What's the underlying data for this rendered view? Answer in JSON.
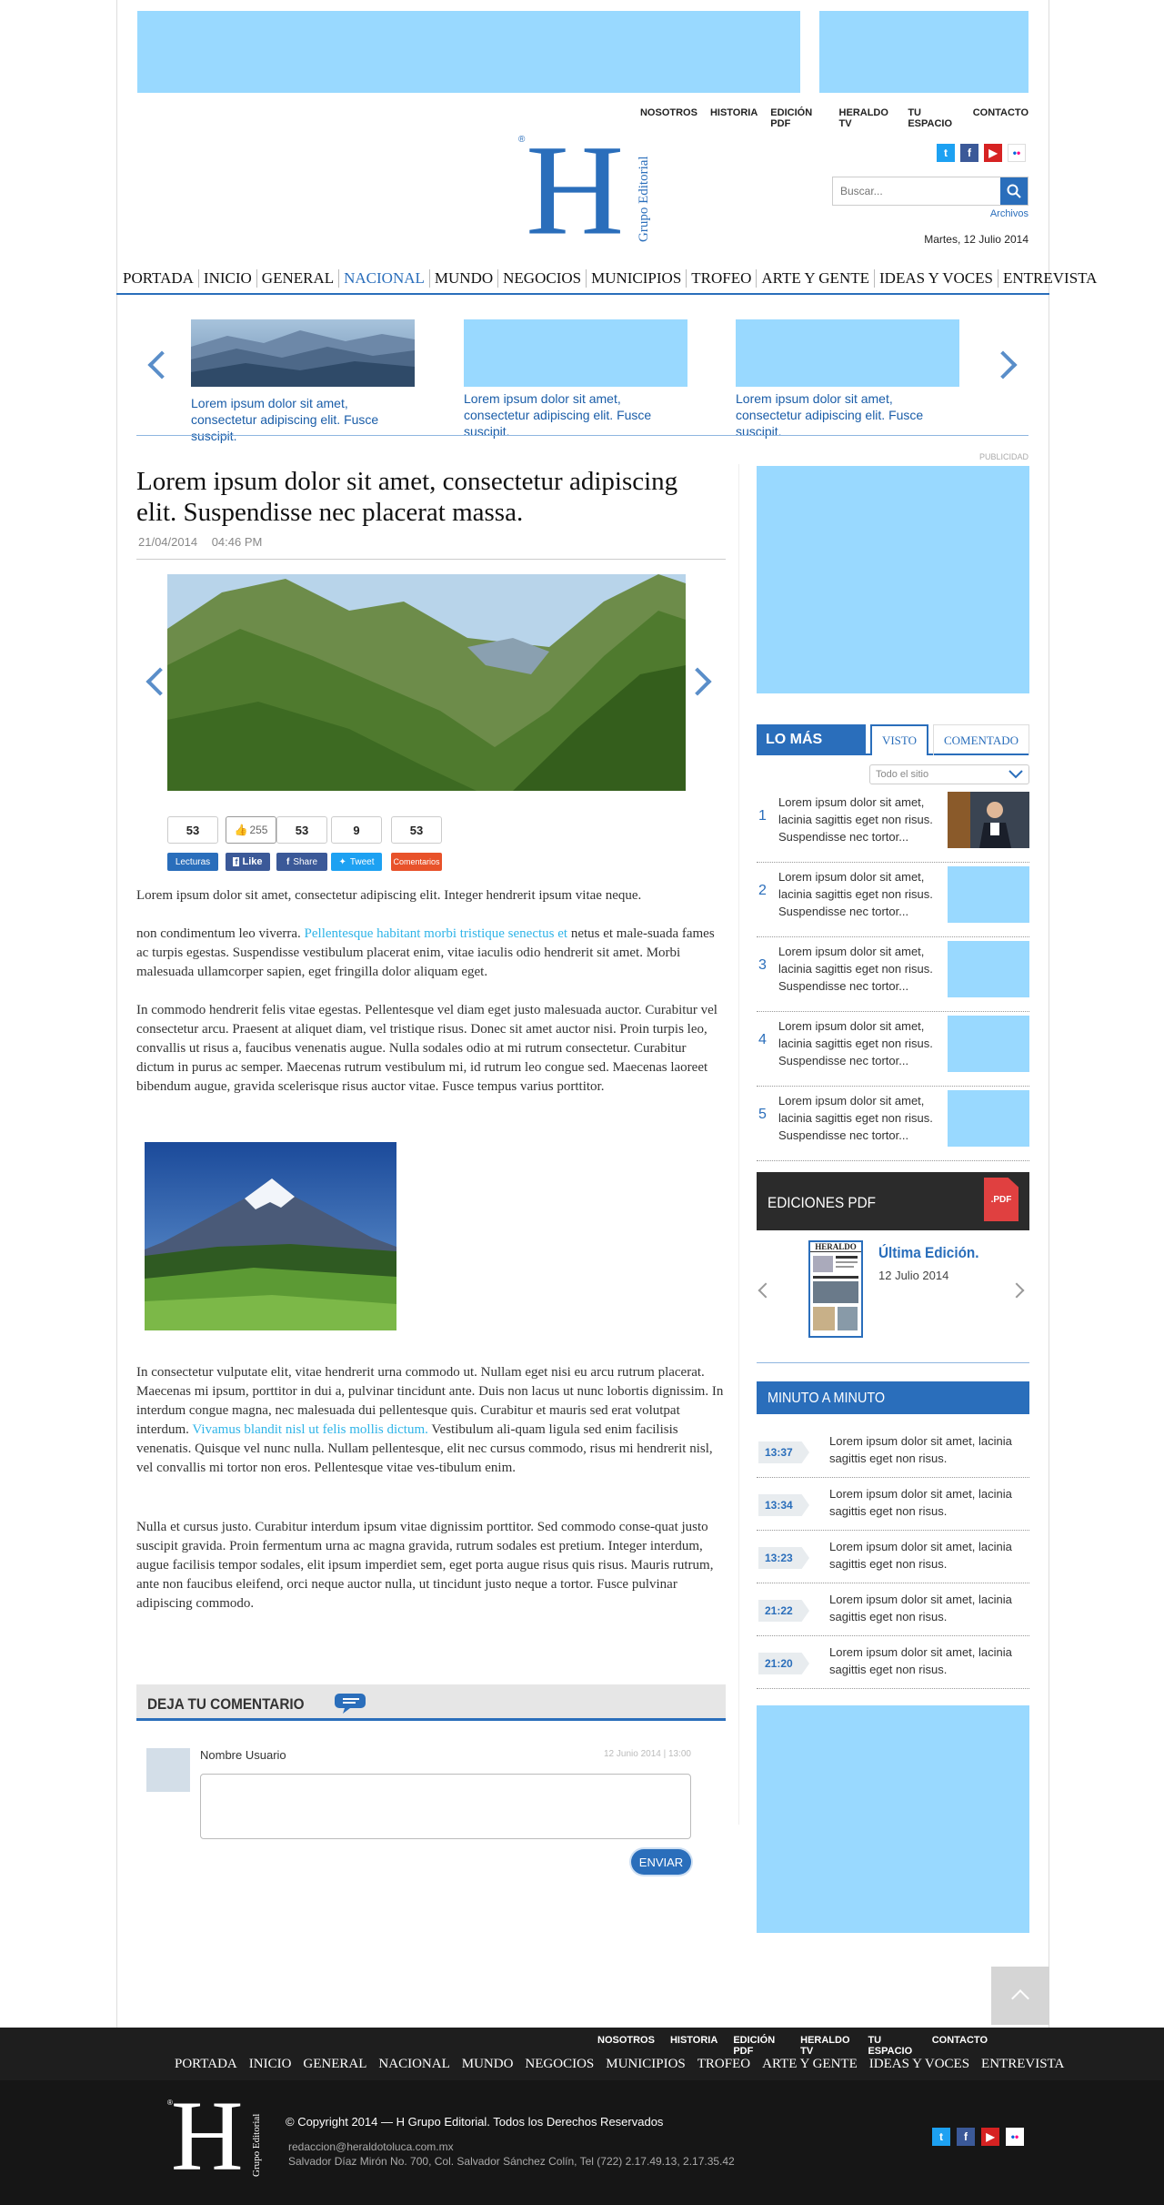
{
  "top_nav": [
    "NOSOTROS",
    "HISTORIA",
    "EDICIÓN PDF",
    "HERALDO TV",
    "TU ESPACIO",
    "CONTACTO"
  ],
  "logo": {
    "letter": "H",
    "text": "Grupo Editorial",
    "mark": "®"
  },
  "search": {
    "placeholder": "Buscar...",
    "archives": "Archivos"
  },
  "date": "Martes, 12 Julio 2014",
  "main_nav": [
    "PORTADA",
    "INICIO",
    "GENERAL",
    "NACIONAL",
    "MUNDO",
    "NEGOCIOS",
    "MUNICIPIOS",
    "TROFEO",
    "ARTE Y GENTE",
    "IDEAS Y VOCES",
    "ENTREVISTA"
  ],
  "main_nav_active": "NACIONAL",
  "carousel": [
    {
      "caption": "Lorem ipsum dolor sit amet, consectetur adipiscing elit. Fusce suscipit."
    },
    {
      "caption": "Lorem ipsum dolor sit amet, consectetur adipiscing elit. Fusce suscipit."
    },
    {
      "caption": "Lorem ipsum dolor sit amet, consectetur adipiscing elit. Fusce suscipit."
    }
  ],
  "ad_label": "PUBLICIDAD",
  "article": {
    "title": "Lorem ipsum dolor sit amet, consectetur adipiscing elit. Suspendisse nec placerat massa.",
    "date": "21/04/2014",
    "time": "04:46 PM",
    "stats": {
      "lecturas": "53",
      "like": "255",
      "share": "53",
      "tweet": "9",
      "comentarios": "53",
      "lecturas_label": "Lecturas",
      "like_label": "Like",
      "share_label": "Share",
      "tweet_label": "Tweet",
      "comentarios_label": "Comentarios"
    },
    "p1": "Lorem ipsum dolor sit amet, consectetur adipiscing elit. Integer hendrerit ipsum vitae neque.",
    "p2a": "non condimentum leo viverra. ",
    "p2link": "Pellentesque habitant morbi tristique senectus et",
    "p2b": " netus et male-suada fames ac turpis egestas. Suspendisse vestibulum placerat enim, vitae iaculis odio hendrerit sit amet. Morbi malesuada ullamcorper sapien, eget fringilla dolor aliquam eget.",
    "p3": "In commodo hendrerit felis vitae egestas. Pellentesque vel diam eget justo malesuada auctor. Curabitur vel consectetur arcu. Praesent at aliquet diam, vel tristique risus. Donec sit amet auctor nisi. Proin turpis leo, convallis ut risus a, faucibus venenatis augue. Nulla sodales odio at mi rutrum consectetur. Curabitur dictum in purus ac semper. Maecenas rutrum vestibulum mi, id rutrum leo congue sed. Maecenas laoreet bibendum augue, gravida scelerisque risus auctor vitae. Fusce tempus varius porttitor.",
    "p4a": "In consectetur vulputate elit, vitae hendrerit urna commodo ut. Nullam eget nisi eu arcu rutrum placerat. Maecenas mi ipsum, porttitor in dui a, pulvinar tincidunt ante. Duis non lacus ut nunc lobortis dignissim. In interdum congue magna, nec malesuada dui pellentesque quis. Curabitur et mauris sed erat volutpat interdum. ",
    "p4link": "Vivamus blandit nisl ut felis mollis dictum.",
    "p4b": " Vestibulum ali-quam ligula sed enim facilisis venenatis. Quisque vel nunc nulla. Nullam pellentesque, elit nec cursus commodo, risus mi hendrerit nisl, vel convallis mi tortor non eros. Pellentesque vitae ves-tibulum enim.",
    "p5": "Nulla et cursus justo. Curabitur interdum ipsum vitae dignissim porttitor. Sed commodo conse-quat justo suscipit gravida. Proin fermentum urna ac magna gravida, rutrum sodales est pretium. Integer interdum, augue facilisis tempor sodales, elit ipsum imperdiet sem, eget porta augue risus quis risus. Mauris rutrum, ante non faucibus eleifend, orci neque auctor nulla, ut tincidunt justo neque a tortor. Fusce pulvinar adipiscing commodo."
  },
  "comment": {
    "title": "DEJA TU COMENTARIO",
    "user": "Nombre Usuario",
    "date": "12 Junio 2014 | 13:00",
    "submit": "ENVIAR"
  },
  "lo_mas": {
    "title": "LO MÁS",
    "tab1": "VISTO",
    "tab2": "COMENTADO",
    "select": "Todo el sitio",
    "items": [
      {
        "num": "1",
        "text": "Lorem ipsum dolor sit amet, lacinia sagittis eget non risus. Suspendisse nec tortor..."
      },
      {
        "num": "2",
        "text": "Lorem ipsum dolor sit amet, lacinia sagittis eget non risus. Suspendisse nec tortor..."
      },
      {
        "num": "3",
        "text": "Lorem ipsum dolor sit amet, lacinia sagittis eget non risus. Suspendisse nec tortor..."
      },
      {
        "num": "4",
        "text": "Lorem ipsum dolor sit amet, lacinia sagittis eget non risus. Suspendisse nec tortor..."
      },
      {
        "num": "5",
        "text": "Lorem ipsum dolor sit amet, lacinia sagittis eget non risus. Suspendisse nec tortor..."
      }
    ]
  },
  "pdf": {
    "title": "EDICIONES PDF",
    "badge": ".PDF",
    "edition": "Última Edición.",
    "edition_date": "12 Julio 2014",
    "cover_name": "HERALDO"
  },
  "minuto": {
    "title": "MINUTO A MINUTO",
    "items": [
      {
        "time": "13:37",
        "text": "Lorem ipsum dolor sit amet,  lacinia sagittis eget non risus."
      },
      {
        "time": "13:34",
        "text": "Lorem ipsum dolor sit amet,  lacinia sagittis eget non risus."
      },
      {
        "time": "13:23",
        "text": "Lorem ipsum dolor sit amet,  lacinia sagittis eget non risus."
      },
      {
        "time": "21:22",
        "text": "Lorem ipsum dolor sit amet,  lacinia sagittis eget non risus."
      },
      {
        "time": "21:20",
        "text": "Lorem ipsum dolor sit amet,  lacinia sagittis eget non risus."
      }
    ]
  },
  "footer": {
    "copyright": "© Copyright 2014 — H Grupo Editorial. Todos los Derechos Reservados",
    "email": "redaccion@heraldotoluca.com.mx",
    "address": "Salvador Díaz Mirón No. 700, Col. Salvador Sánchez Colín, Tel (722) 2.17.49.13, 2.17.35.42"
  },
  "icons": {
    "twitter": "twitter-icon",
    "facebook": "facebook-icon",
    "youtube": "youtube-icon",
    "flickr": "flickr-icon",
    "search": "search-icon",
    "back_to_top": "chevron-up-icon",
    "comment": "speech-bubble-icon"
  },
  "colors": {
    "brand_blue": "#2a6ebb",
    "ad_placeholder": "#99d9ff",
    "link_cyan": "#2fb4e8",
    "dark_footer": "#1e1e1e",
    "pdf_red": "#e04040"
  }
}
